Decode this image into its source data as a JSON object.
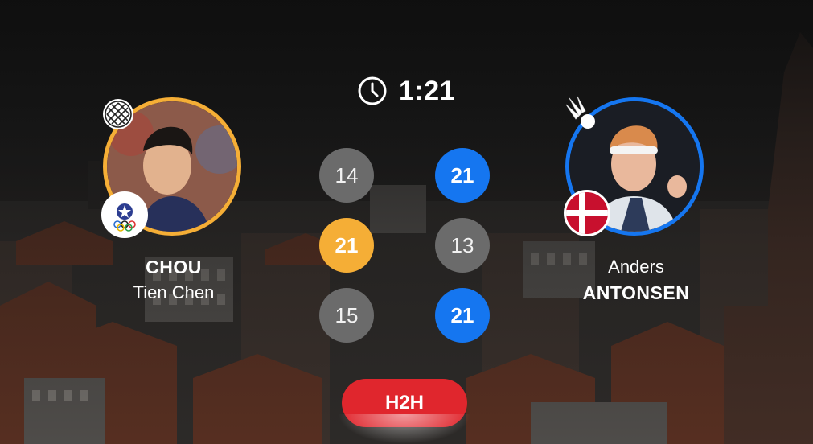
{
  "match": {
    "duration": "1:21",
    "h2h_label": "H2H"
  },
  "player_left": {
    "surname": "CHOU",
    "given_name": "Tien Chen",
    "ring_color": "#f5ae36",
    "flag": "chinese-taipei-flag",
    "role_icon": "racket-icon"
  },
  "player_right": {
    "given_name": "Anders",
    "surname": "ANTONSEN",
    "ring_color": "#1576f0",
    "flag": "denmark-flag",
    "role_icon": "shuttlecock-icon"
  },
  "games": [
    {
      "left": "14",
      "right": "21",
      "winner": "right"
    },
    {
      "left": "21",
      "right": "13",
      "winner": "left"
    },
    {
      "left": "15",
      "right": "21",
      "winner": "right"
    }
  ],
  "colors": {
    "left_win": "#f5ae36",
    "right_win": "#1576f0",
    "lose": "#6b6b6b",
    "h2h_button": "#e0262d"
  }
}
